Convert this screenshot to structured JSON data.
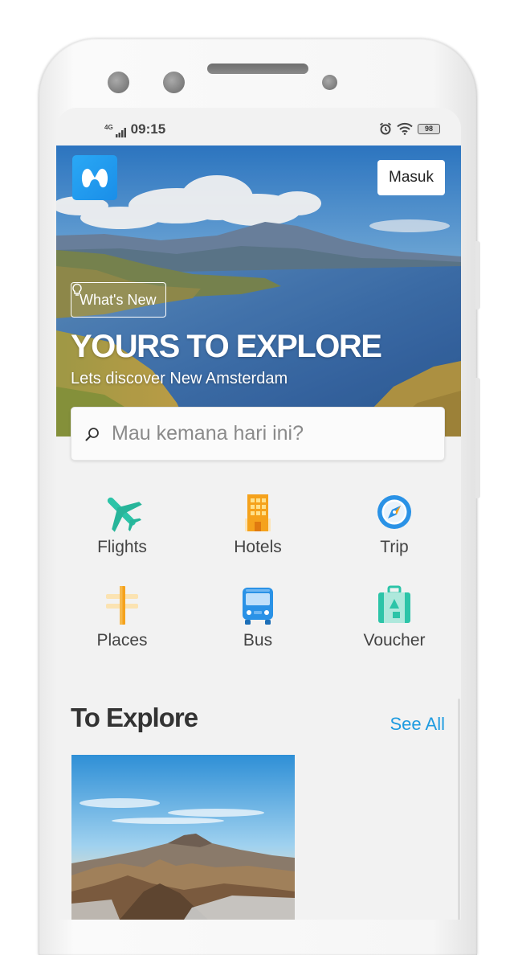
{
  "status_bar": {
    "network": "4G",
    "time": "09:15",
    "battery": "98"
  },
  "header": {
    "login_label": "Masuk"
  },
  "hero": {
    "badge": "What's New",
    "title": "YOURS TO EXPLORE",
    "subtitle": "Lets discover New Amsterdam"
  },
  "search": {
    "placeholder": "Mau kemana hari ini?"
  },
  "menu": [
    {
      "label": "Flights",
      "icon": "airplane-icon"
    },
    {
      "label": "Hotels",
      "icon": "building-icon"
    },
    {
      "label": "Trip",
      "icon": "compass-icon"
    },
    {
      "label": "Places",
      "icon": "signpost-icon"
    },
    {
      "label": "Bus",
      "icon": "bus-icon"
    },
    {
      "label": "Voucher",
      "icon": "luggage-icon"
    }
  ],
  "explore": {
    "title": "To Explore",
    "see_all": "See All"
  },
  "colors": {
    "accent": "#1e9be0",
    "icon_teal": "#2cc4a8",
    "icon_orange": "#f5a21c",
    "logo_blue": "#2aa8f5"
  }
}
